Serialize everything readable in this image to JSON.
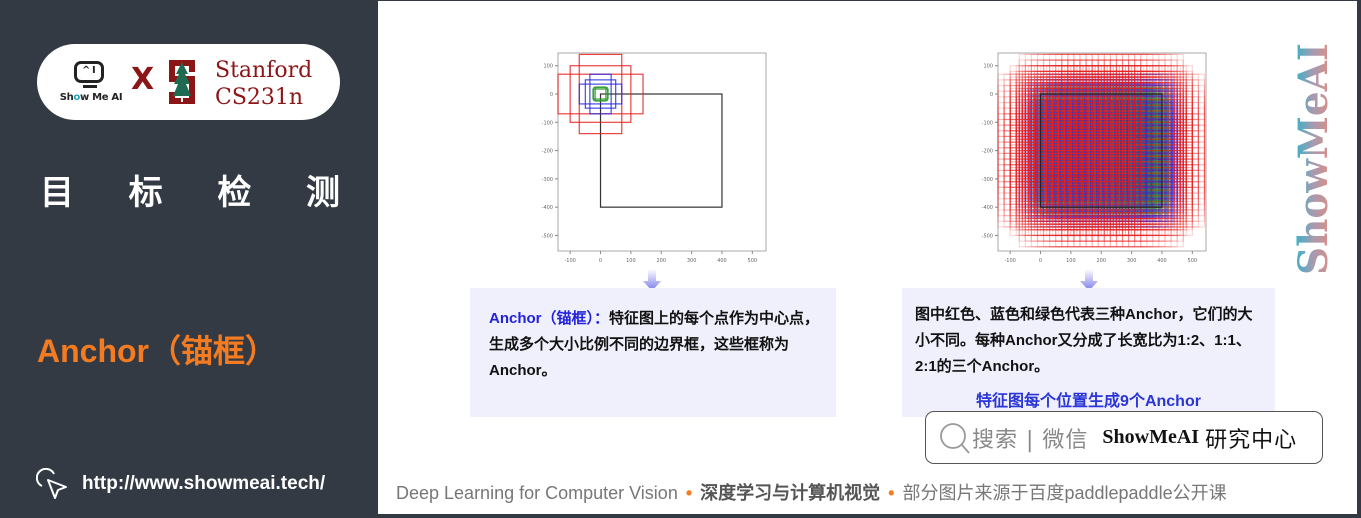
{
  "sidebar": {
    "logo": {
      "showmeai_text_pre": "Sh",
      "showmeai_text_o": "o",
      "showmeai_text_post": "w Me AI",
      "x_mark": "X",
      "stanford_line1": "Stanford",
      "stanford_line2": "CS231n"
    },
    "title_chars": [
      "目",
      "标",
      "检",
      "测"
    ],
    "subtitle": "Anchor（锚框）",
    "url": "http://www.showmeai.tech/"
  },
  "main": {
    "charts": [
      {
        "name": "single-location-anchors",
        "x_ticks": [
          "-100",
          "0",
          "100",
          "200",
          "300",
          "400",
          "500"
        ],
        "y_ticks": [
          "100",
          "0",
          "-100",
          "-200",
          "-300",
          "-400",
          "-500"
        ]
      },
      {
        "name": "all-location-anchors",
        "x_ticks": [
          "-100",
          "0",
          "100",
          "200",
          "300",
          "400",
          "500"
        ],
        "y_ticks": [
          "100",
          "0",
          "-100",
          "-200",
          "-300",
          "-400",
          "-500"
        ]
      }
    ],
    "desc1": {
      "term": "Anchor（锚框）",
      "colon": "：",
      "text": "特征图上的每个点作为中心点，生成多个大小比例不同的边界框，这些框称为Anchor。"
    },
    "desc2": {
      "text": "图中红色、蓝色和绿色代表三种Anchor，它们的大小不同。每种Anchor又分成了长宽比为1:2、1:1、2:1的三个Anchor。",
      "highlight": "特征图每个位置生成9个Anchor"
    },
    "search": {
      "label": "搜索 | 微信",
      "brand": "ShowMeAI",
      "brand_suffix": "研究中心"
    },
    "footer": {
      "en": "Deep Learning for Computer Vision",
      "sep": "•",
      "cn_bold": "深度学习与计算机视觉",
      "source": "部分图片来源于百度paddlepaddle公开课"
    },
    "watermark": "ShowMeAI"
  },
  "colors": {
    "sidebar_bg": "#333a44",
    "accent_orange": "#f47b20",
    "stanford_red": "#8c1515",
    "highlight_blue": "#2a35d8",
    "desc_bg": "#f0f0fc"
  }
}
